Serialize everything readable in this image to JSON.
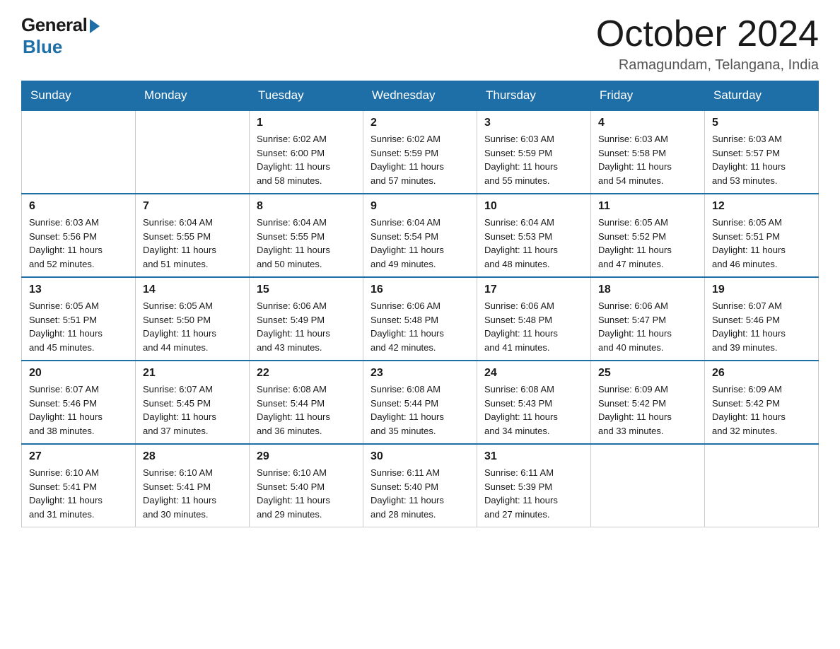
{
  "logo": {
    "general": "General",
    "blue": "Blue"
  },
  "title": "October 2024",
  "subtitle": "Ramagundam, Telangana, India",
  "weekdays": [
    "Sunday",
    "Monday",
    "Tuesday",
    "Wednesday",
    "Thursday",
    "Friday",
    "Saturday"
  ],
  "weeks": [
    [
      {
        "day": "",
        "info": ""
      },
      {
        "day": "",
        "info": ""
      },
      {
        "day": "1",
        "info": "Sunrise: 6:02 AM\nSunset: 6:00 PM\nDaylight: 11 hours\nand 58 minutes."
      },
      {
        "day": "2",
        "info": "Sunrise: 6:02 AM\nSunset: 5:59 PM\nDaylight: 11 hours\nand 57 minutes."
      },
      {
        "day": "3",
        "info": "Sunrise: 6:03 AM\nSunset: 5:59 PM\nDaylight: 11 hours\nand 55 minutes."
      },
      {
        "day": "4",
        "info": "Sunrise: 6:03 AM\nSunset: 5:58 PM\nDaylight: 11 hours\nand 54 minutes."
      },
      {
        "day": "5",
        "info": "Sunrise: 6:03 AM\nSunset: 5:57 PM\nDaylight: 11 hours\nand 53 minutes."
      }
    ],
    [
      {
        "day": "6",
        "info": "Sunrise: 6:03 AM\nSunset: 5:56 PM\nDaylight: 11 hours\nand 52 minutes."
      },
      {
        "day": "7",
        "info": "Sunrise: 6:04 AM\nSunset: 5:55 PM\nDaylight: 11 hours\nand 51 minutes."
      },
      {
        "day": "8",
        "info": "Sunrise: 6:04 AM\nSunset: 5:55 PM\nDaylight: 11 hours\nand 50 minutes."
      },
      {
        "day": "9",
        "info": "Sunrise: 6:04 AM\nSunset: 5:54 PM\nDaylight: 11 hours\nand 49 minutes."
      },
      {
        "day": "10",
        "info": "Sunrise: 6:04 AM\nSunset: 5:53 PM\nDaylight: 11 hours\nand 48 minutes."
      },
      {
        "day": "11",
        "info": "Sunrise: 6:05 AM\nSunset: 5:52 PM\nDaylight: 11 hours\nand 47 minutes."
      },
      {
        "day": "12",
        "info": "Sunrise: 6:05 AM\nSunset: 5:51 PM\nDaylight: 11 hours\nand 46 minutes."
      }
    ],
    [
      {
        "day": "13",
        "info": "Sunrise: 6:05 AM\nSunset: 5:51 PM\nDaylight: 11 hours\nand 45 minutes."
      },
      {
        "day": "14",
        "info": "Sunrise: 6:05 AM\nSunset: 5:50 PM\nDaylight: 11 hours\nand 44 minutes."
      },
      {
        "day": "15",
        "info": "Sunrise: 6:06 AM\nSunset: 5:49 PM\nDaylight: 11 hours\nand 43 minutes."
      },
      {
        "day": "16",
        "info": "Sunrise: 6:06 AM\nSunset: 5:48 PM\nDaylight: 11 hours\nand 42 minutes."
      },
      {
        "day": "17",
        "info": "Sunrise: 6:06 AM\nSunset: 5:48 PM\nDaylight: 11 hours\nand 41 minutes."
      },
      {
        "day": "18",
        "info": "Sunrise: 6:06 AM\nSunset: 5:47 PM\nDaylight: 11 hours\nand 40 minutes."
      },
      {
        "day": "19",
        "info": "Sunrise: 6:07 AM\nSunset: 5:46 PM\nDaylight: 11 hours\nand 39 minutes."
      }
    ],
    [
      {
        "day": "20",
        "info": "Sunrise: 6:07 AM\nSunset: 5:46 PM\nDaylight: 11 hours\nand 38 minutes."
      },
      {
        "day": "21",
        "info": "Sunrise: 6:07 AM\nSunset: 5:45 PM\nDaylight: 11 hours\nand 37 minutes."
      },
      {
        "day": "22",
        "info": "Sunrise: 6:08 AM\nSunset: 5:44 PM\nDaylight: 11 hours\nand 36 minutes."
      },
      {
        "day": "23",
        "info": "Sunrise: 6:08 AM\nSunset: 5:44 PM\nDaylight: 11 hours\nand 35 minutes."
      },
      {
        "day": "24",
        "info": "Sunrise: 6:08 AM\nSunset: 5:43 PM\nDaylight: 11 hours\nand 34 minutes."
      },
      {
        "day": "25",
        "info": "Sunrise: 6:09 AM\nSunset: 5:42 PM\nDaylight: 11 hours\nand 33 minutes."
      },
      {
        "day": "26",
        "info": "Sunrise: 6:09 AM\nSunset: 5:42 PM\nDaylight: 11 hours\nand 32 minutes."
      }
    ],
    [
      {
        "day": "27",
        "info": "Sunrise: 6:10 AM\nSunset: 5:41 PM\nDaylight: 11 hours\nand 31 minutes."
      },
      {
        "day": "28",
        "info": "Sunrise: 6:10 AM\nSunset: 5:41 PM\nDaylight: 11 hours\nand 30 minutes."
      },
      {
        "day": "29",
        "info": "Sunrise: 6:10 AM\nSunset: 5:40 PM\nDaylight: 11 hours\nand 29 minutes."
      },
      {
        "day": "30",
        "info": "Sunrise: 6:11 AM\nSunset: 5:40 PM\nDaylight: 11 hours\nand 28 minutes."
      },
      {
        "day": "31",
        "info": "Sunrise: 6:11 AM\nSunset: 5:39 PM\nDaylight: 11 hours\nand 27 minutes."
      },
      {
        "day": "",
        "info": ""
      },
      {
        "day": "",
        "info": ""
      }
    ]
  ],
  "colors": {
    "header_bg": "#1e6fa8",
    "header_text": "#ffffff",
    "border_top": "#1e6fa8"
  }
}
